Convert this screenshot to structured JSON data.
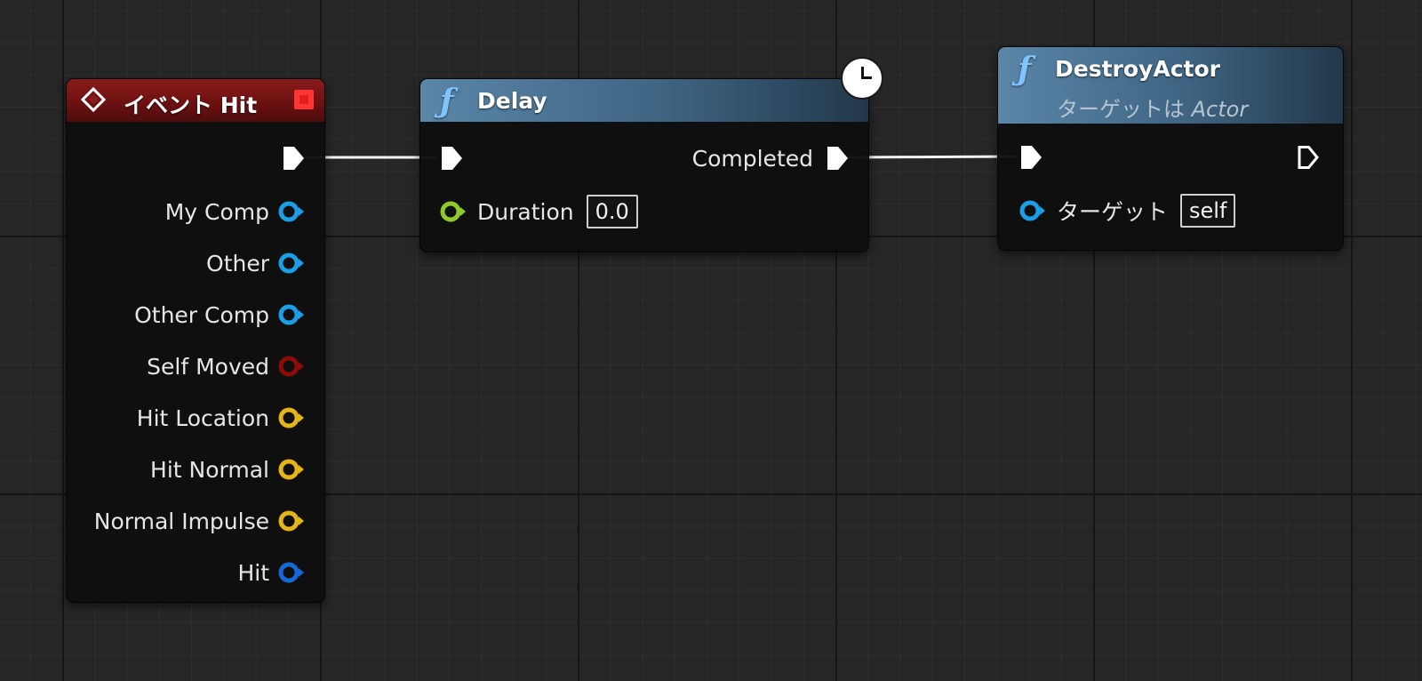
{
  "colors": {
    "exec": "#ffffff",
    "object": "#1a9ee8",
    "bool": "#8c0c0c",
    "vector": "#e3b516",
    "struct": "#1569d6",
    "float": "#8ecb2a",
    "event_header": "#8a1c1c",
    "function_header": "#4a7394"
  },
  "event_node": {
    "title": "イベント Hit",
    "icon": "event-diamond-icon",
    "pins": [
      {
        "label": "My Comp",
        "type": "object"
      },
      {
        "label": "Other",
        "type": "object"
      },
      {
        "label": "Other Comp",
        "type": "object"
      },
      {
        "label": "Self Moved",
        "type": "bool"
      },
      {
        "label": "Hit Location",
        "type": "vector"
      },
      {
        "label": "Hit Normal",
        "type": "vector"
      },
      {
        "label": "Normal Impulse",
        "type": "vector"
      },
      {
        "label": "Hit",
        "type": "struct"
      }
    ]
  },
  "delay_node": {
    "title": "Delay",
    "icon": "function-icon",
    "badge": "clock-icon",
    "output_exec_label": "Completed",
    "duration_label": "Duration",
    "duration_value": "0.0"
  },
  "destroy_node": {
    "title": "DestroyActor",
    "subtitle_prefix": "ターゲットは ",
    "subtitle_class": "Actor",
    "icon": "function-icon",
    "target_label": "ターゲット",
    "target_value": "self"
  }
}
